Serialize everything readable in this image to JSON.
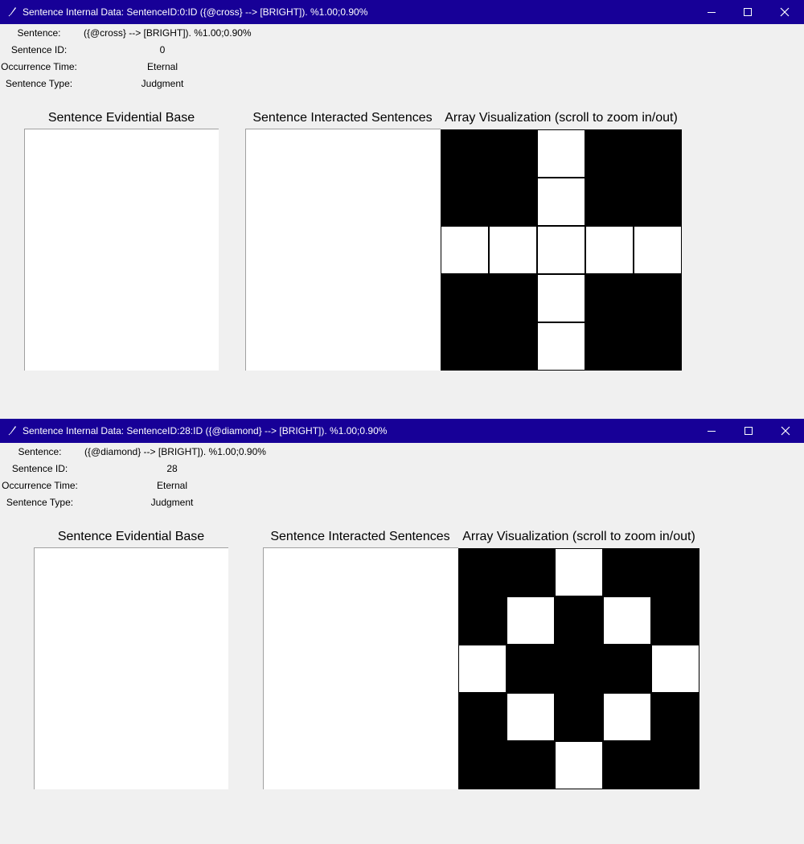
{
  "windows": [
    {
      "title": "Sentence Internal Data: SentenceID:0:ID ({@cross} --> [BRIGHT]). %1.00;0.90%",
      "fields": [
        {
          "label": "Sentence:",
          "value": "({@cross} --> [BRIGHT]). %1.00;0.90%"
        },
        {
          "label": "Sentence ID:",
          "value": "0"
        },
        {
          "label": "Occurrence Time:",
          "value": "Eternal"
        },
        {
          "label": "Sentence Type:",
          "value": "Judgment"
        }
      ],
      "evidential_base_heading": "Sentence Evidential Base",
      "interacted_heading": "Sentence Interacted Sentences",
      "array_heading": "Array Visualization (scroll to zoom in/out)",
      "array": [
        [
          1,
          1,
          0,
          1,
          1
        ],
        [
          1,
          1,
          0,
          1,
          1
        ],
        [
          0,
          0,
          0,
          0,
          0
        ],
        [
          1,
          1,
          0,
          1,
          1
        ],
        [
          1,
          1,
          0,
          1,
          1
        ]
      ]
    },
    {
      "title": "Sentence Internal Data: SentenceID:28:ID ({@diamond} --> [BRIGHT]). %1.00;0.90%",
      "fields": [
        {
          "label": "Sentence:",
          "value": "({@diamond} --> [BRIGHT]). %1.00;0.90%"
        },
        {
          "label": "Sentence ID:",
          "value": "28"
        },
        {
          "label": "Occurrence Time:",
          "value": "Eternal"
        },
        {
          "label": "Sentence Type:",
          "value": "Judgment"
        }
      ],
      "evidential_base_heading": "Sentence Evidential Base",
      "interacted_heading": "Sentence Interacted Sentences",
      "array_heading": "Array Visualization (scroll to zoom in/out)",
      "array": [
        [
          1,
          1,
          0,
          1,
          1
        ],
        [
          1,
          0,
          1,
          0,
          1
        ],
        [
          0,
          1,
          1,
          1,
          0
        ],
        [
          1,
          0,
          1,
          0,
          1
        ],
        [
          1,
          1,
          0,
          1,
          1
        ]
      ]
    }
  ],
  "icons": {
    "app": "feather-icon",
    "minimize": "minimize-icon",
    "maximize": "maximize-icon",
    "close": "close-icon"
  },
  "colors": {
    "titlebar": "#170097",
    "background": "#f0f0f0"
  }
}
